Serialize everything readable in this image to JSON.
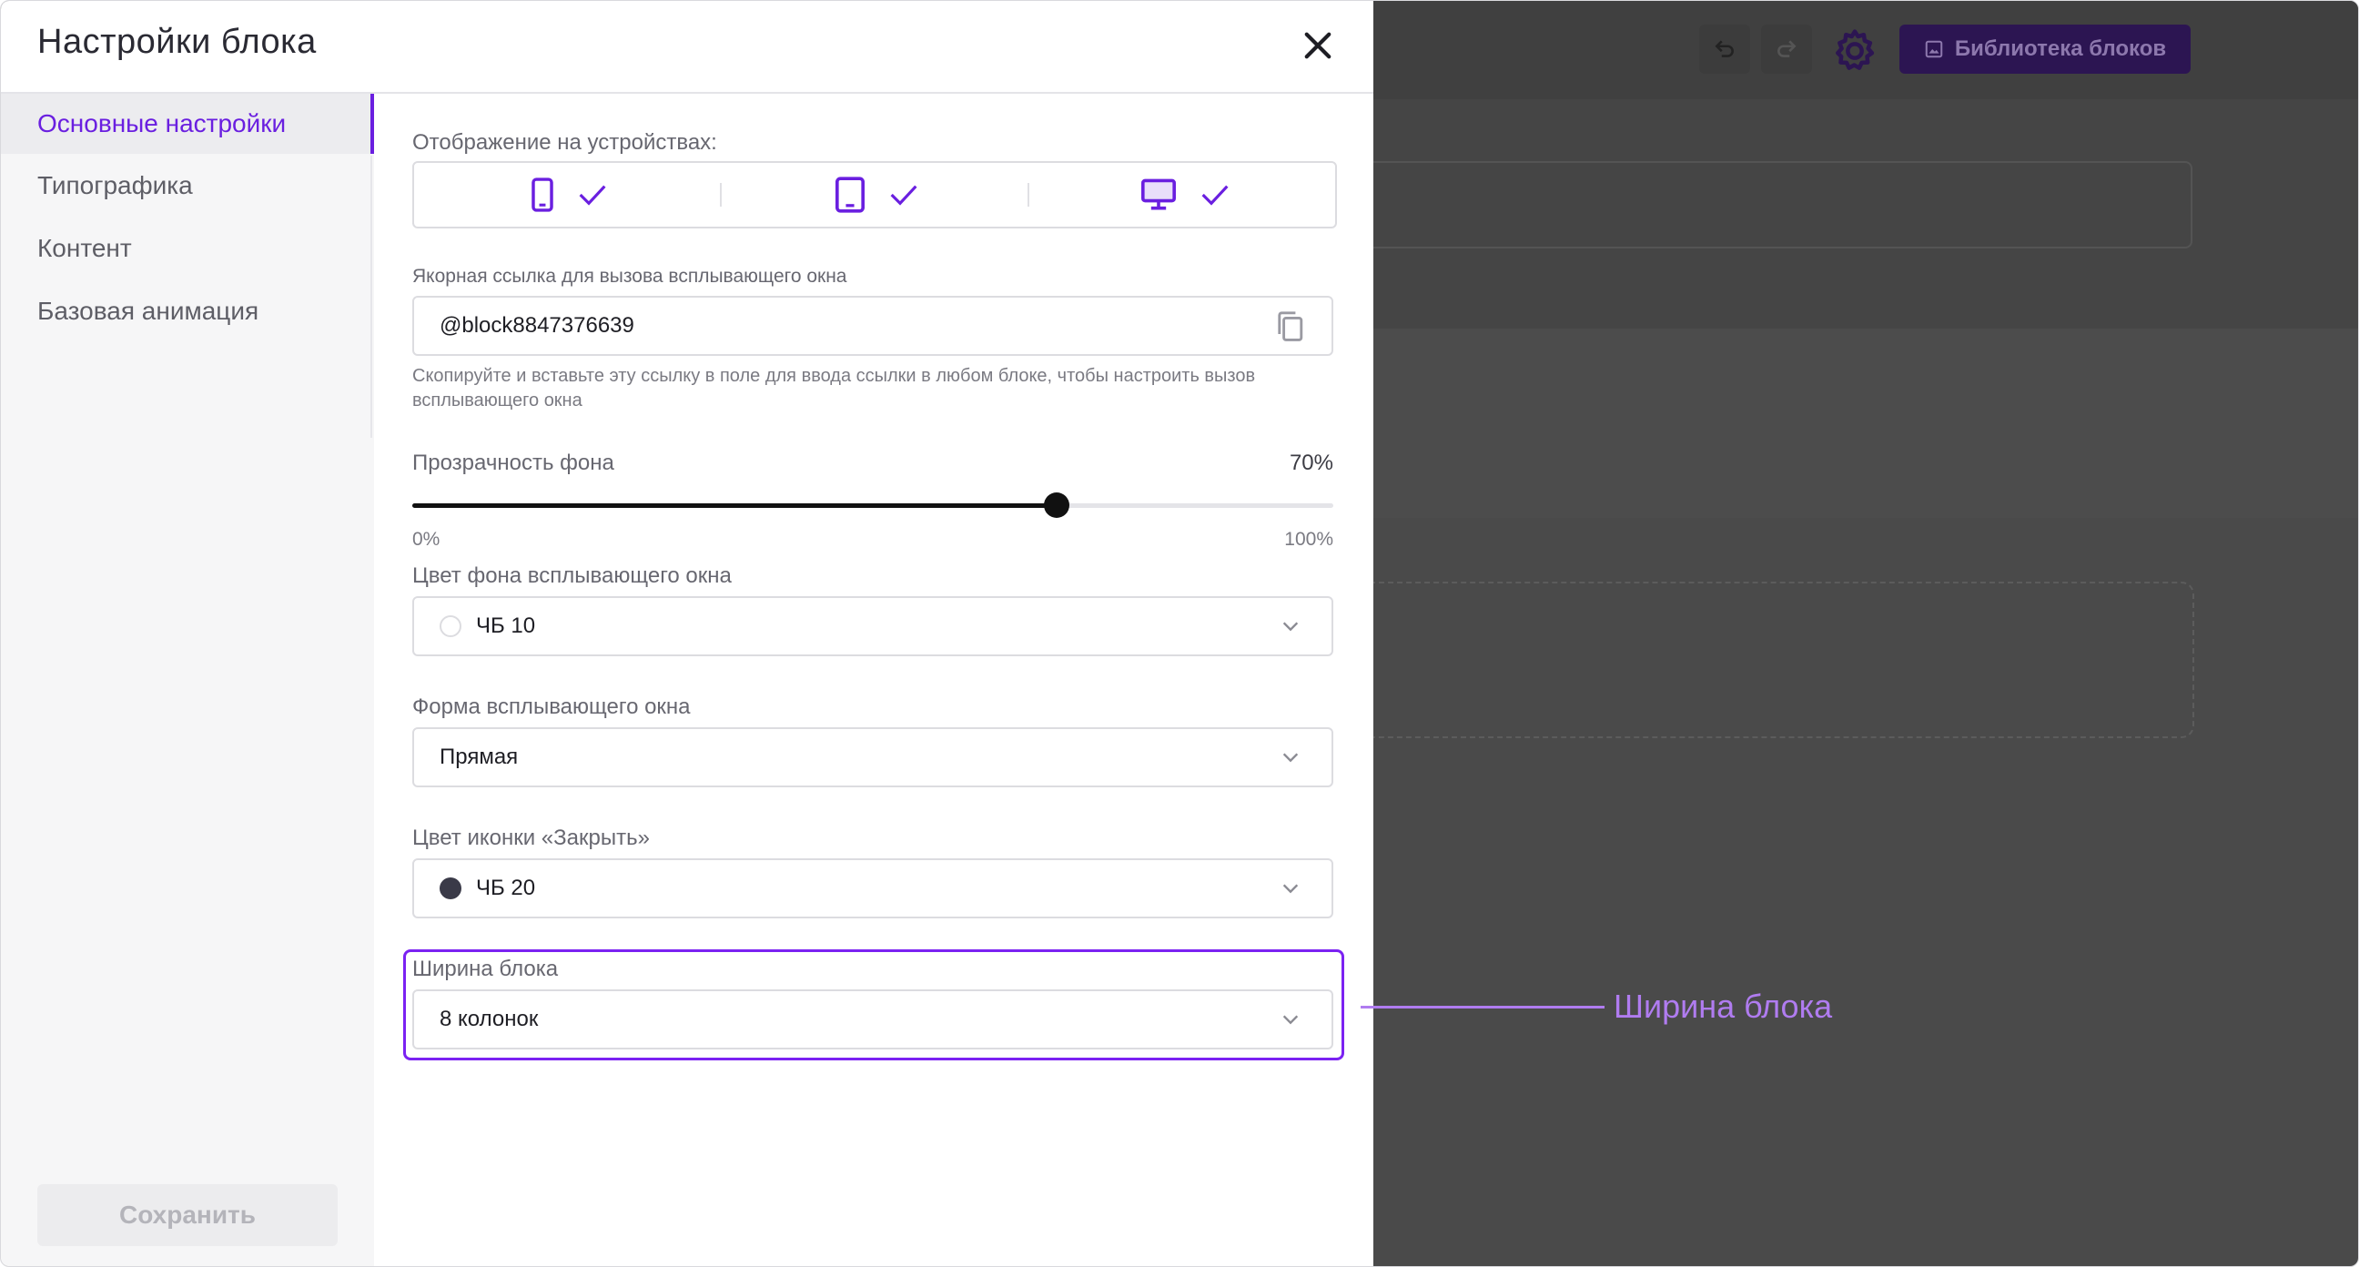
{
  "dialog": {
    "title": "Настройки блока"
  },
  "sidebar": {
    "items": [
      {
        "label": "Основные настройки",
        "active": true
      },
      {
        "label": "Типографика",
        "active": false
      },
      {
        "label": "Контент",
        "active": false
      },
      {
        "label": "Базовая анимация",
        "active": false
      }
    ],
    "save_label": "Сохранить"
  },
  "devices": {
    "label": "Отображение на устройствах:",
    "items": [
      {
        "icon": "mobile-icon",
        "checked": true
      },
      {
        "icon": "tablet-icon",
        "checked": true
      },
      {
        "icon": "desktop-icon",
        "checked": true
      }
    ]
  },
  "anchor": {
    "label": "Якорная ссылка для вызова всплывающего окна",
    "value": "@block8847376639",
    "hint": "Скопируйте и вставьте эту ссылку в поле для ввода ссылки в любом блоке, чтобы настроить вызов всплывающего окна",
    "copy_icon": "copy-icon"
  },
  "opacity": {
    "label": "Прозрачность фона",
    "value_text": "70%",
    "value": 70,
    "min_label": "0%",
    "max_label": "100%"
  },
  "bg_color": {
    "label": "Цвет фона всплывающего окна",
    "value": "ЧБ 10",
    "swatch": "#ffffff"
  },
  "shape": {
    "label": "Форма всплывающего окна",
    "value": "Прямая"
  },
  "close_color": {
    "label": "Цвет иконки «Закрыть»",
    "value": "ЧБ 20",
    "swatch": "#3a3a48"
  },
  "width": {
    "label": "Ширина блока",
    "value": "8 колонок"
  },
  "callout": {
    "text": "Ширина блока"
  },
  "background_editor": {
    "library_label": "Библиотека блоков"
  },
  "colors": {
    "accent": "#6a1fe0",
    "highlight": "#7b22f2",
    "callout": "#b07cf0"
  }
}
